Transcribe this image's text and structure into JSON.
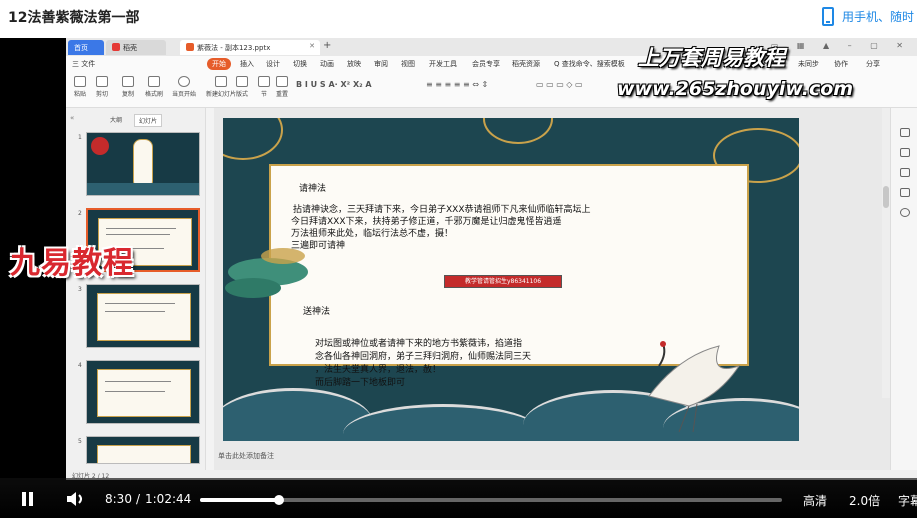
{
  "page": {
    "title": "12法善紫薇法第一部",
    "mobile_link": "用手机、随时"
  },
  "wps": {
    "tabs": [
      {
        "label": "首页"
      },
      {
        "label": "稻壳"
      },
      {
        "label": "紫薇法 - 副本123.pptx"
      }
    ],
    "menu": [
      "三 文件",
      "开始",
      "插入",
      "设计",
      "切换",
      "动画",
      "放映",
      "审阅",
      "视图",
      "开发工具",
      "会员专享",
      "稻壳资源",
      "Q 查找命令、搜索模板"
    ],
    "menu_right": [
      "未同步",
      "协作",
      "分享"
    ],
    "ribbon_buttons": [
      "粘贴",
      "剪切",
      "复制",
      "格式刷",
      "当页开始",
      "新建幻灯片",
      "版式",
      "节",
      "重置"
    ],
    "panel_tabs": [
      "大纲",
      "幻灯片"
    ],
    "slide_numbers": [
      "1",
      "2",
      "3",
      "4",
      "5"
    ],
    "notes_hint": "单击此处添加备注",
    "status_left": "幻灯片 2 / 12"
  },
  "slide": {
    "heading1": "请神法",
    "body1": [
      "拈请神诀念，三天拜请下来，今日弟子XXX恭请祖师下凡来仙师临轩高坛上",
      "今日拜请XXX下来，扶持弟子修正道，千邪万魔是让归虚鬼怪皆逍遥",
      "万法祖师来此处，临坛行法总不虚，摄！",
      "三遍即可请神"
    ],
    "red_label": "教学管请管招生y86341106",
    "heading2": "送神法",
    "body2": [
      "对坛图或神位或者请神下来的地方书紫薇讳，掐道指",
      "念各仙各神回洞府，弟子三拜归洞府，仙师赐法同三天",
      "，法生天堂真人界，退法，赦！",
      "而后脚踏一下地板即可"
    ]
  },
  "watermarks": {
    "top": "上万套周易教程",
    "url": "www.265zhouyiw.com",
    "left": "九易教程"
  },
  "player": {
    "current_time": "8:30",
    "separator": "/",
    "total_time": "1:02:44",
    "progress_fraction": 0.135,
    "quality": "高清",
    "speed": "2.0倍",
    "subtitle": "字幕"
  },
  "colors": {
    "accent_orange": "#e65c2a",
    "player_bg": "#000000",
    "slide_bg": "#1d4650",
    "gold": "#c9a24b",
    "link_blue": "#1e88e5"
  }
}
